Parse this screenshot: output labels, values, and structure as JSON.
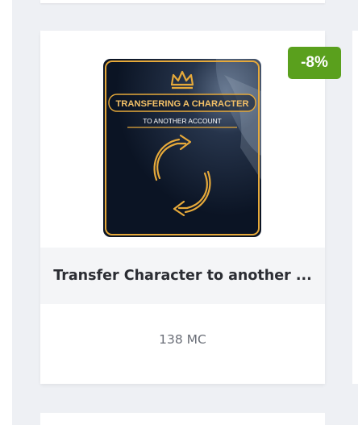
{
  "product": {
    "title": "Transfer Character to another ...",
    "price": "138 MC",
    "discount_badge": "-8%",
    "image": {
      "heading_line1": "TRANSFERING A CHARACTER",
      "heading_line2": "TO ANOTHER ACCOUNT",
      "icons": [
        "crown-icon",
        "transfer-arrows-icon"
      ]
    }
  },
  "colors": {
    "badge": "#5aa01d",
    "page_background": "#eef0f4",
    "title_band": "#f4f5f7",
    "title_text": "#2b2d33",
    "price_text": "#6b6f78",
    "image_gold": "#e6a93a",
    "image_dark": "#0b1424"
  }
}
